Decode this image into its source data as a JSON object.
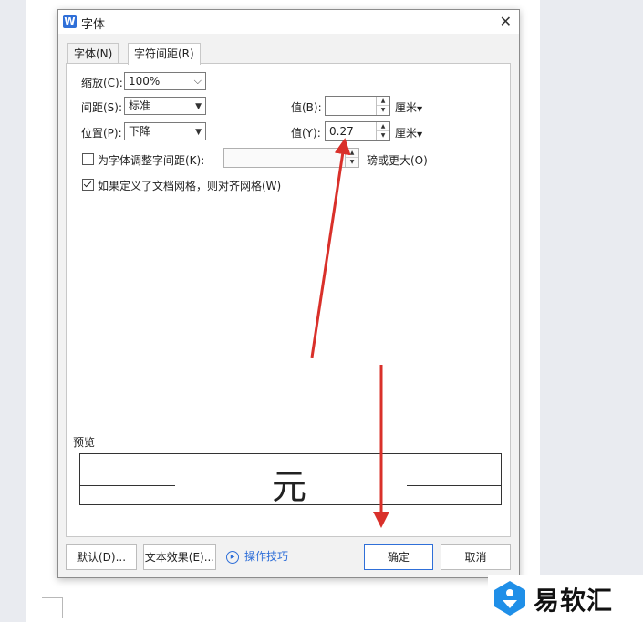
{
  "dialog": {
    "title": "字体",
    "app_icon_letter": "W",
    "close_symbol": "✕"
  },
  "tabs": [
    {
      "label": "字体(N)",
      "active": false
    },
    {
      "label": "字符间距(R)",
      "active": true
    }
  ],
  "spacing": {
    "scale_label": "缩放(C):",
    "scale_value": "100%",
    "spacing_label": "间距(S):",
    "spacing_value": "标准",
    "position_label": "位置(P):",
    "position_value": "下降",
    "by1_label": "值(B):",
    "by1_value": "",
    "by1_unit": "厘米",
    "by2_label": "值(Y):",
    "by2_value": "0.27",
    "by2_unit": "厘米",
    "kerning_label": "为字体调整字间距(K):",
    "kerning_checked": false,
    "kerning_value": "",
    "kerning_unit": "磅或更大(O)",
    "grid_label": "如果定义了文档网格，则对齐网格(W)",
    "grid_checked": true
  },
  "preview": {
    "label": "预览",
    "sample": "元"
  },
  "buttons": {
    "default": "默认(D)...",
    "text_effects": "文本效果(E)...",
    "tips": "操作技巧",
    "ok": "确定",
    "cancel": "取消"
  },
  "watermark": {
    "text": "易软汇"
  },
  "colors": {
    "accent": "#2f6fd8",
    "annotation_arrow": "#d9302a"
  },
  "icons": {
    "app": "wps-writer-icon",
    "close": "close-icon",
    "tips": "play-circle-icon",
    "dropdown": "chevron-down-icon",
    "spin_up": "spin-up-icon",
    "spin_down": "spin-down-icon",
    "watermark_logo": "yiruanhui-logo-icon"
  }
}
